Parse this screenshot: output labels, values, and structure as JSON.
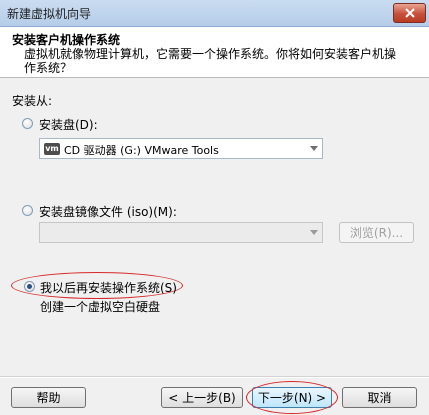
{
  "window": {
    "title": "新建虚拟机向导",
    "close_icon": "close-icon"
  },
  "header": {
    "title": "安装客户机操作系统",
    "description": "虚拟机就像物理计算机，它需要一个操作系统。你将如何安装客户机操作系统？"
  },
  "install_from": {
    "label": "安装从:",
    "disc": {
      "label": "安装盘(D):",
      "selected": false,
      "drive_value": "CD 驱动器 (G:) VMware Tools",
      "drive_icon": "vm"
    },
    "iso": {
      "label": "安装盘镜像文件 (iso)(M):",
      "selected": false,
      "path_value": "",
      "browse_label": "浏览(R)..."
    },
    "later": {
      "label": "我以后再安装操作系统(S)",
      "selected": true,
      "description": "创建一个虚拟空白硬盘"
    }
  },
  "footer": {
    "help_label": "帮助",
    "back_label": "< 上一步(B)",
    "next_label": "下一步(N) >",
    "cancel_label": "取消"
  },
  "colors": {
    "annotation": "#d62828",
    "titlebar": "#b6cde9",
    "close": "#c7503a"
  }
}
